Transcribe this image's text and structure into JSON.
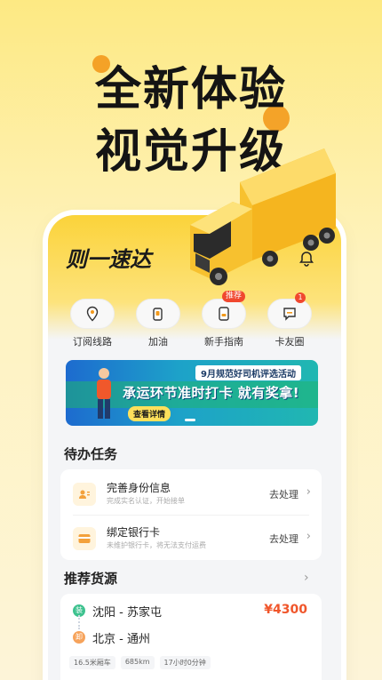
{
  "headline": {
    "line1": "全新体验",
    "line2": "视觉升级"
  },
  "app": {
    "logo_text": "则一速达"
  },
  "quick_actions": [
    {
      "label": "订阅线路",
      "icon": "location-pin-icon",
      "badge": ""
    },
    {
      "label": "加油",
      "icon": "fuel-icon",
      "badge": ""
    },
    {
      "label": "新手指南",
      "icon": "guide-icon",
      "badge": "推荐"
    },
    {
      "label": "卡友圈",
      "icon": "chat-icon",
      "badge": "1"
    }
  ],
  "banner": {
    "tag": "9月规范好司机评选活动",
    "main_text": "承运环节准时打卡 就有奖拿!",
    "button_label": "查看详情"
  },
  "todo": {
    "title": "待办任务",
    "items": [
      {
        "title": "完善身份信息",
        "subtitle": "完成实名认证，开始接单",
        "action": "去处理"
      },
      {
        "title": "绑定银行卡",
        "subtitle": "未维护银行卡，将无法支付运费",
        "action": "去处理"
      }
    ]
  },
  "recommend": {
    "title": "推荐货源",
    "cargo": {
      "from_tag": "装",
      "from": "沈阳 - 苏家屯",
      "to_tag": "卸",
      "to": "北京 - 通州",
      "price": "¥4300",
      "chips": [
        "16.5米厢车",
        "685km",
        "17小时0分钟"
      ]
    }
  },
  "colors": {
    "brand_yellow": "#fbd33a",
    "accent_orange": "#f39a1c",
    "price_red": "#f0562b"
  }
}
